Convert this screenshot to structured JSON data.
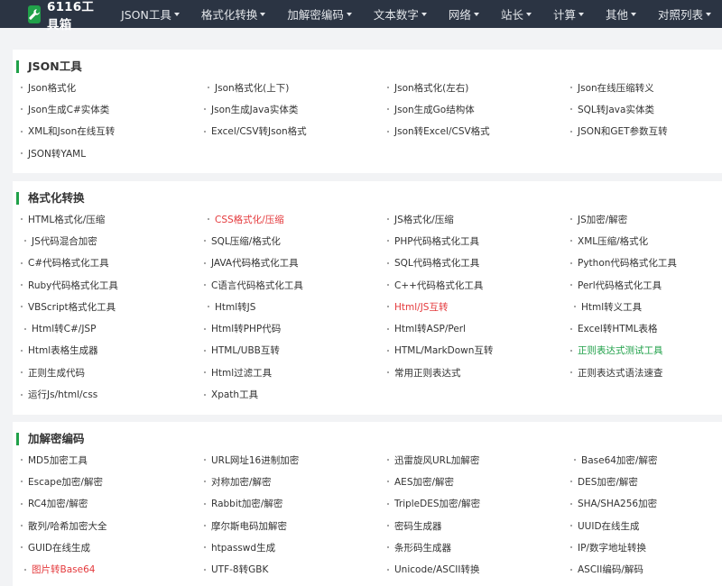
{
  "logo": {
    "text": "6116工具箱",
    "icon": "wrench-icon"
  },
  "nav": [
    "JSON工具",
    "格式化转换",
    "加解密编码",
    "文本数字",
    "网络",
    "站长",
    "计算",
    "其他",
    "对照列表"
  ],
  "colors": {
    "topbar": "#2b3443",
    "accent": "#21a14a",
    "highlight_red": "#e4393c",
    "highlight_green": "#21a14a"
  },
  "sections": [
    {
      "title": "JSON工具",
      "items": [
        "Json格式化",
        "Json格式化(上下)",
        "Json格式化(左右)",
        "Json在线压缩转义",
        "Json生成C#实体类",
        "Json生成Java实体类",
        "Json生成Go结构体",
        "SQL转Java实体类",
        "XML和Json在线互转",
        "Excel/CSV转Json格式",
        "Json转Excel/CSV格式",
        "JSON和GET参数互转",
        "JSON转YAML"
      ]
    },
    {
      "title": "格式化转换",
      "items": [
        "HTML格式化/压缩",
        "CSS格式化/压缩",
        "JS格式化/压缩",
        "JS加密/解密",
        "JS代码混合加密",
        "SQL压缩/格式化",
        "PHP代码格式化工具",
        "XML压缩/格式化",
        "C#代码格式化工具",
        "JAVA代码格式化工具",
        "SQL代码格式化工具",
        "Python代码格式化工具",
        "Ruby代码格式化工具",
        "C语言代码格式化工具",
        "C++代码格式化工具",
        "Perl代码格式化工具",
        "VBScript格式化工具",
        "Html转JS",
        "Html/JS互转",
        "Html转义工具",
        "Html转C#/JSP",
        "Html转PHP代码",
        "Html转ASP/Perl",
        "Excel转HTML表格",
        "Html表格生成器",
        "HTML/UBB互转",
        "HTML/MarkDown互转",
        "正则表达式测试工具",
        "正则生成代码",
        "Html过滤工具",
        "常用正则表达式",
        "正则表达式语法速查",
        "运行Js/html/css",
        "Xpath工具"
      ]
    },
    {
      "title": "加解密编码",
      "items": [
        "MD5加密工具",
        "URL网址16进制加密",
        "迅雷旋风URL加解密",
        "Base64加密/解密",
        "Escape加密/解密",
        "对称加密/解密",
        "AES加密/解密",
        "DES加密/解密",
        "RC4加密/解密",
        "Rabbit加密/解密",
        "TripleDES加密/解密",
        "SHA/SHA256加密",
        "散列/哈希加密大全",
        "摩尔斯电码加解密",
        "密码生成器",
        "UUID在线生成",
        "GUID在线生成",
        "htpasswd生成",
        "条形码生成器",
        "IP/数字地址转换",
        "图片转Base64",
        "UTF-8转GBK",
        "Unicode/ASCII转换",
        "ASCII编码/解码"
      ]
    }
  ]
}
